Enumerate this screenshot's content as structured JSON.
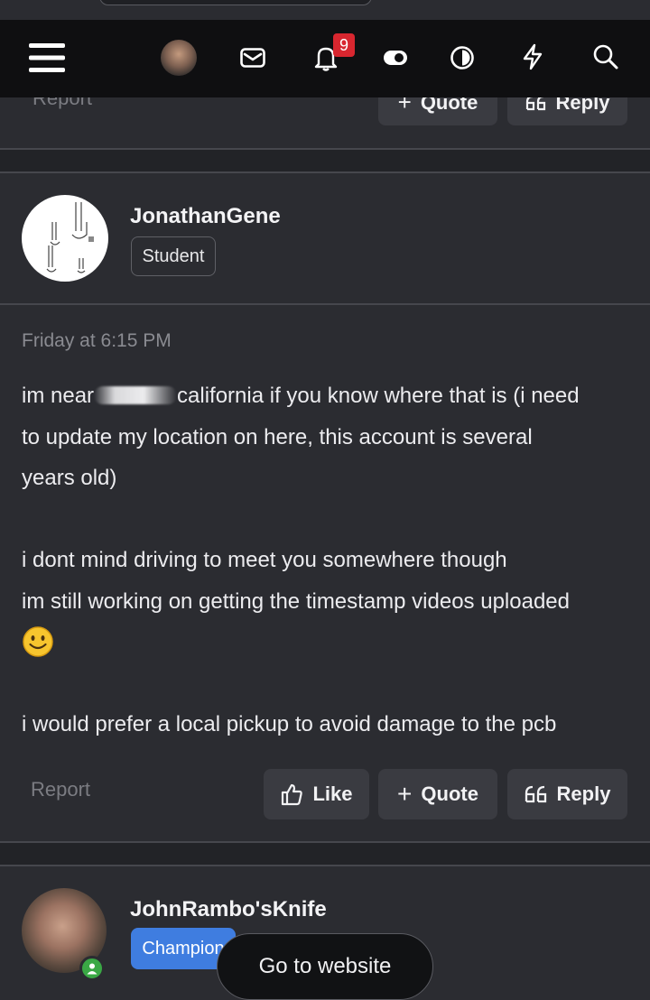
{
  "prev_post": {
    "report_label": "Report",
    "quote_label": "Quote",
    "reply_label": "Reply"
  },
  "nav": {
    "menu_icon": "hamburger-menu-icon",
    "avatar_icon": "user-avatar",
    "mail_icon": "envelope-icon",
    "bell_icon": "bell-icon",
    "notification_count": "9",
    "toggle_icon": "toggle-icon",
    "contrast_icon": "contrast-icon",
    "bolt_icon": "lightning-icon",
    "search_icon": "search-icon"
  },
  "post": {
    "username": "JonathanGene",
    "role": "Student",
    "timestamp": "Friday at 6:15 PM",
    "line1_a": "im near",
    "line1_b": "california if you know where that is (i need",
    "line2": "to update my location on here, this account is several",
    "line3": "years old)",
    "line4": "i dont mind driving to meet you somewhere though",
    "line5": "im still working on getting the timestamp videos uploaded",
    "line6": "i would prefer a local pickup to avoid damage to the pcb",
    "report_label": "Report",
    "like_label": "Like",
    "quote_label": "Quote",
    "reply_label": "Reply"
  },
  "next_post": {
    "username": "JohnRambo'sKnife",
    "role": "Champion"
  },
  "floating": {
    "goto_label": "Go to website"
  },
  "colors": {
    "background": "#2b2c31",
    "nav": "#0f0f11",
    "button": "#3a3b41",
    "champion": "#3f7de0",
    "badge": "#d8262f"
  }
}
